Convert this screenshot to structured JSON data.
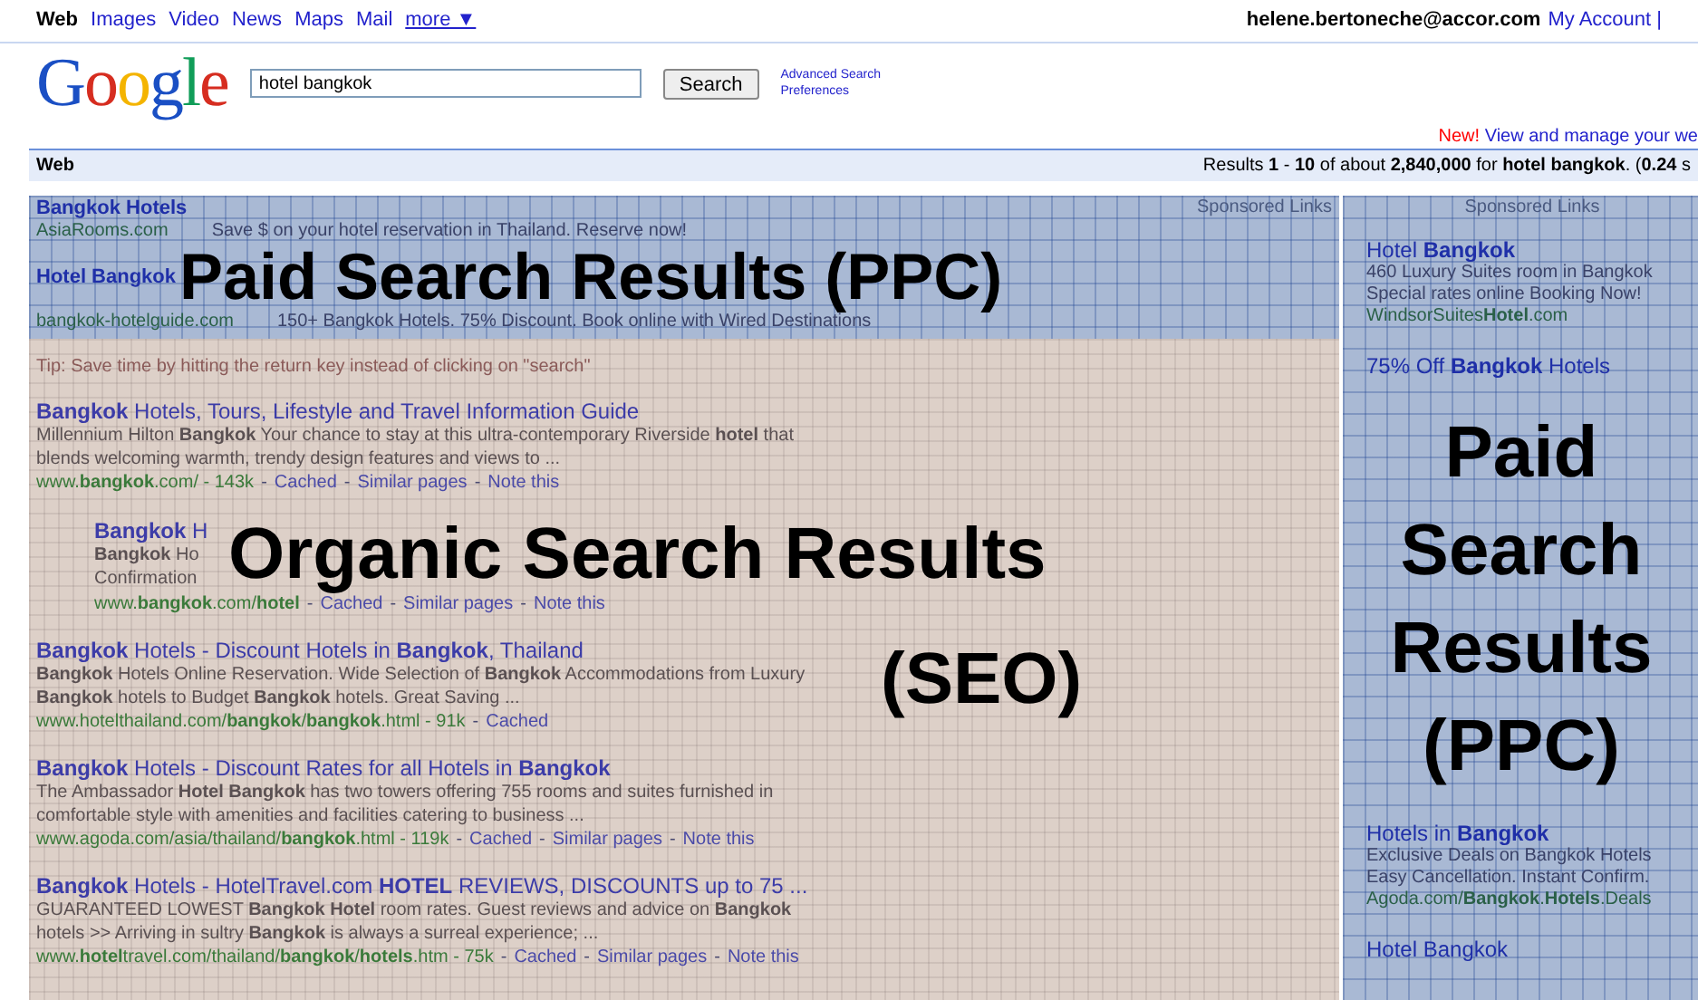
{
  "top_nav": {
    "items": [
      {
        "label": "Web",
        "selected": true
      },
      {
        "label": "Images",
        "selected": false
      },
      {
        "label": "Video",
        "selected": false
      },
      {
        "label": "News",
        "selected": false
      },
      {
        "label": "Maps",
        "selected": false
      },
      {
        "label": "Mail",
        "selected": false
      }
    ],
    "more": "more ▼",
    "account": "helene.bertoneche@accor.com",
    "account_link": "My Account |"
  },
  "header": {
    "logo": "Google",
    "search_value": "hotel bangkok",
    "search_button": "Search",
    "links": [
      "Advanced Search",
      "Preferences"
    ]
  },
  "notice": {
    "new": "New!",
    "text": "View and manage your we"
  },
  "results_bar": {
    "label": "Web",
    "summary": "Results **1** - **10** of about **2,840,000** for **hotel bangkok**. (**0.24** s"
  },
  "top_ads": {
    "sponsored": "Sponsored Links",
    "overlay_label": "Paid Search Results (PPC)",
    "ads": [
      {
        "title": "**Bangkok** Hotels",
        "url": "AsiaRooms.com",
        "text": "Save $ on your hotel reservation in Thailand. Reserve now!"
      },
      {
        "title": "Hotel Bangkok",
        "url": "bangkok-hotelguide.com",
        "text": "150+ Bangkok Hotels. 75% Discount. Book online with Wired Destinations"
      }
    ]
  },
  "organic": {
    "tip": "Tip: Save time by hitting the return key instead of clicking on \"search\"",
    "overlay_labels": [
      "Organic Search Results",
      "(SEO)"
    ],
    "separator": "-",
    "results": [
      {
        "title": "**Bangkok** Hotels, Tours, Lifestyle and Travel Information Guide",
        "snippet": "Millennium Hilton **Bangkok** Your chance to stay at this ultra-contemporary Riverside **hotel** that blends welcoming warmth, trendy design features and views to ...",
        "url": "www.**bangkok**.com/ - 143k",
        "links": [
          "Cached",
          "Similar pages",
          "Note this"
        ]
      }
    ],
    "partial_result": {
      "title": "**Bangkok** H",
      "lines": [
        "**Bangkok** Ho",
        "Confirmation"
      ],
      "url": "www.**bangkok**.com/**hotel**",
      "links": [
        "Cached",
        "Similar pages",
        "Note this"
      ]
    },
    "results_after": [
      {
        "title": "**Bangkok** Hotels - Discount Hotels in **Bangkok**, Thailand",
        "snippet": "**Bangkok** Hotels Online Reservation. Wide Selection of **Bangkok** Accommodations from Luxury **Bangkok** hotels to Budget **Bangkok** hotels. Great Saving ...",
        "url": "www.hotelthailand.com/**bangkok**/**bangkok**.html - 91k",
        "links": [
          "Cached"
        ]
      },
      {
        "title": "**Bangkok** Hotels - Discount Rates for all Hotels in **Bangkok**",
        "snippet": "The Ambassador **Hotel Bangkok** has two towers offering 755 rooms and suites furnished in comfortable style with amenities and facilities catering to business ...",
        "url": "www.agoda.com/asia/thailand/**bangkok**.html - 119k",
        "links": [
          "Cached",
          "Similar pages",
          "Note this"
        ]
      },
      {
        "title": "**Bangkok** Hotels - HotelTravel.com **HOTEL** REVIEWS, DISCOUNTS up to 75 ...",
        "snippet": "GUARANTEED LOWEST **Bangkok Hotel** room rates. Guest reviews and advice on **Bangkok** hotels >> Arriving in sultry **Bangkok** is always a surreal experience; ...",
        "url": "www.**hotel**travel.com/thailand/**bangkok**/**hotels**.htm - 75k",
        "links": [
          "Cached",
          "Similar pages",
          "Note this"
        ]
      }
    ]
  },
  "side_ads": {
    "sponsored": "Sponsored Links",
    "overlay_label": "Paid Search Results (PPC)",
    "ads_above": [
      {
        "title": "Hotel **Bangkok**",
        "lines": [
          "460 Luxury Suites room in Bangkok",
          "Special rates online Booking Now!"
        ],
        "url": "WindsorSuites**Hotel**.com"
      },
      {
        "title": "75% Off **Bangkok** Hotels"
      }
    ],
    "ads_below": [
      {
        "title": "Hotels in **Bangkok**",
        "lines": [
          "Exclusive Deals on Bangkok Hotels",
          "Easy Cancellation. Instant Confirm."
        ],
        "url": "Agoda.com/**Bangkok**.**Hotels**.Deals"
      },
      {
        "title": "Hotel Bangkok"
      }
    ]
  }
}
